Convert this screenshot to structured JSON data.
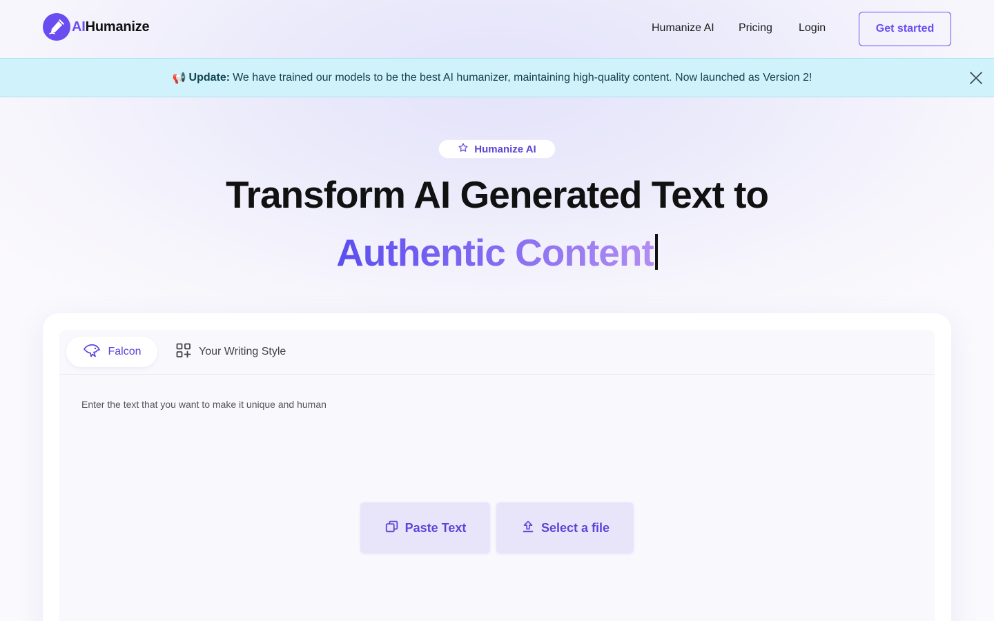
{
  "brand": {
    "logo_ai": "AI",
    "logo_rest": "Humanize",
    "accent": "#6a4df0"
  },
  "nav": {
    "items": [
      "Humanize AI",
      "Pricing",
      "Login"
    ],
    "cta": "Get started"
  },
  "banner": {
    "emoji": "📢",
    "label": "Update:",
    "message": "We have trained our models to be the best AI humanizer, maintaining high-quality content. Now launched as Version 2!",
    "bg": "#cff2fb"
  },
  "hero": {
    "pill": "Humanize AI",
    "title": "Transform AI Generated Text to",
    "highlight": "Authentic Content"
  },
  "editor": {
    "tabs": [
      {
        "label": "Falcon",
        "icon": "falcon-icon",
        "active": true
      },
      {
        "label": "Your Writing Style",
        "icon": "grid-plus-icon",
        "active": false
      }
    ],
    "placeholder": "Enter the text that you want to make it unique and human",
    "paste_label": "Paste Text",
    "file_label": "Select a file"
  }
}
